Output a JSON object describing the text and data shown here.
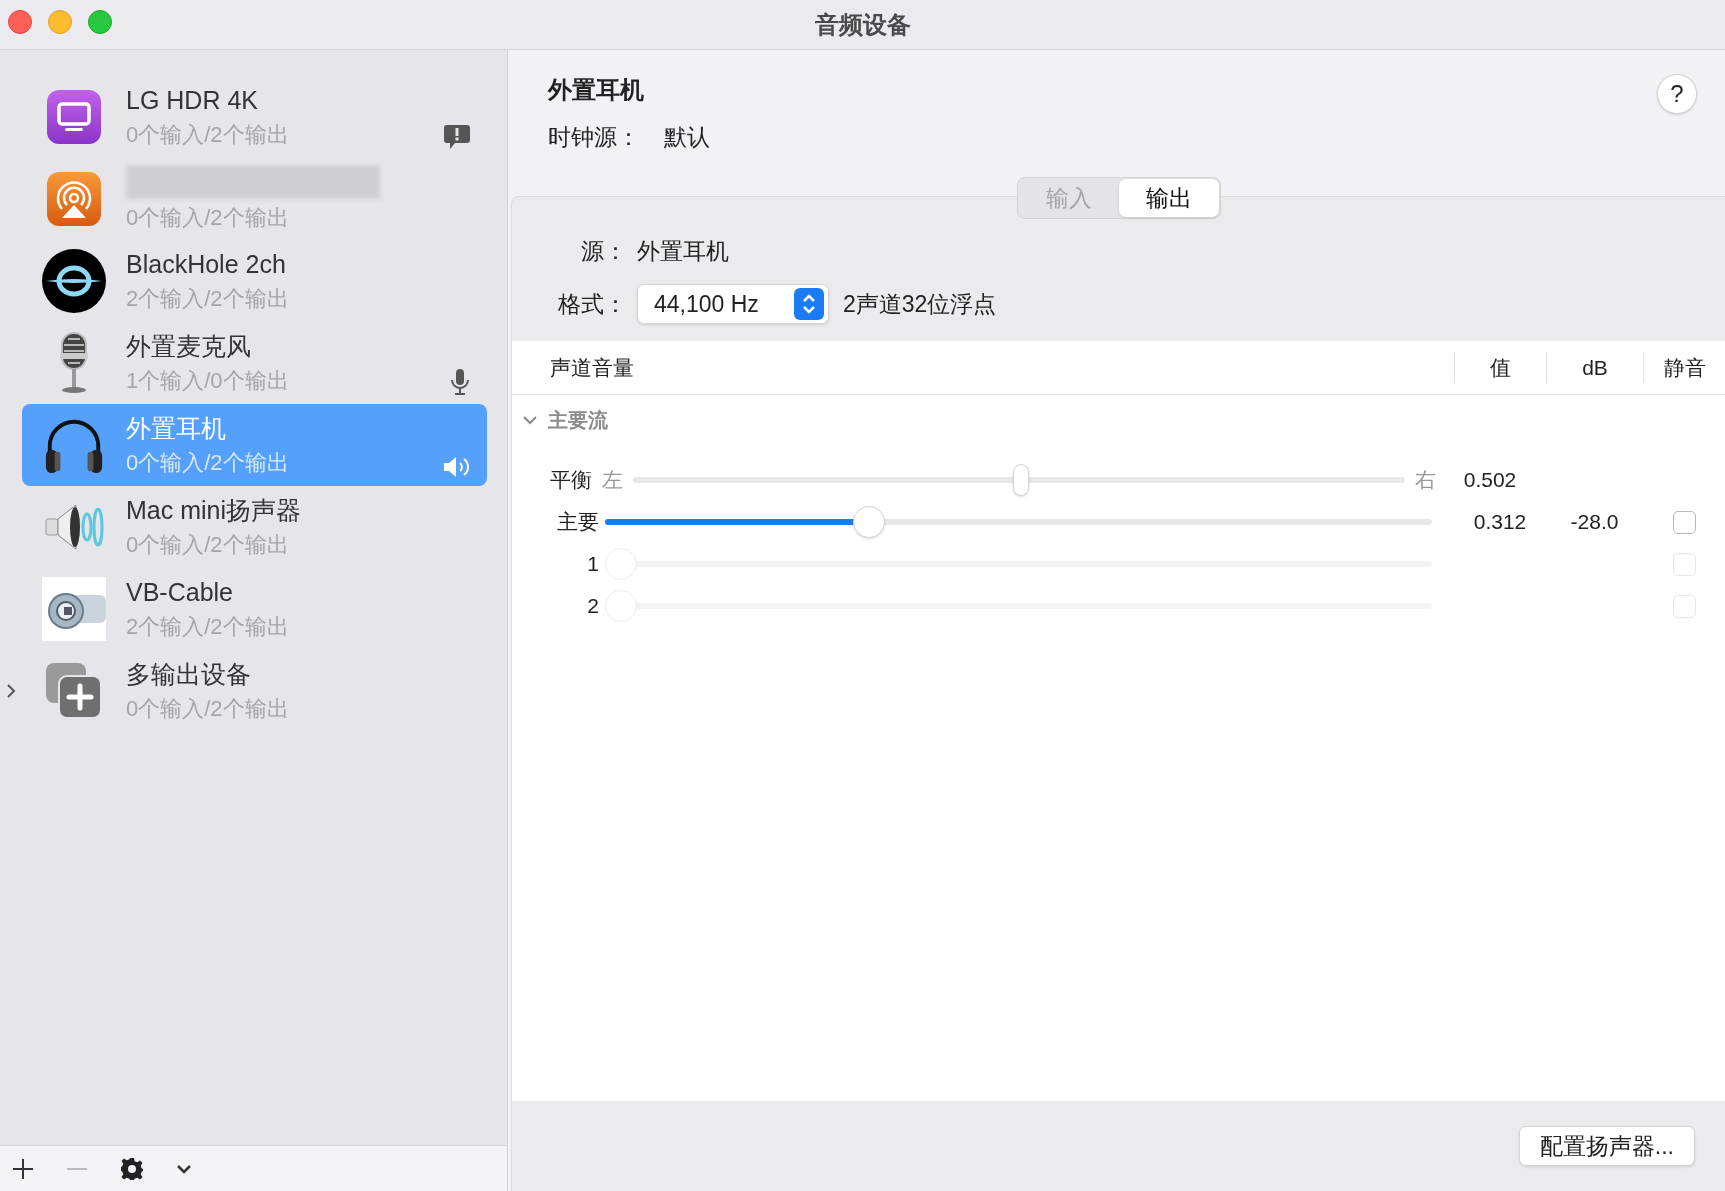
{
  "window": {
    "title": "音频设备"
  },
  "devices": [
    {
      "kind": "display",
      "name": "LG HDR 4K",
      "io": "0个输入/2个输出",
      "badge": {
        "kind": "alert"
      },
      "selected": false
    },
    {
      "kind": "airplay",
      "redacted": true,
      "io": "0个输入/2个输出",
      "selected": false
    },
    {
      "kind": "blackhole",
      "name": "BlackHole 2ch",
      "io": "2个输入/2个输出",
      "selected": false
    },
    {
      "kind": "microphone",
      "name": "外置麦克风",
      "io": "1个输入/0个输出",
      "badge": {
        "kind": "mic"
      },
      "selected": false
    },
    {
      "kind": "headphones",
      "name": "外置耳机",
      "io": "0个输入/2个输出",
      "badge": {
        "kind": "speaker"
      },
      "selected": true
    },
    {
      "kind": "speaker",
      "name": "Mac mini扬声器",
      "io": "0个输入/2个输出",
      "selected": false
    },
    {
      "kind": "cable",
      "name": "VB-Cable",
      "io": "2个输入/2个输出",
      "selected": false
    },
    {
      "kind": "aggregate",
      "name": "多输出设备",
      "io": "0个输入/2个输出",
      "expanded": false,
      "selected": false
    }
  ],
  "sidebar_toolbar": {
    "remove_disabled": true
  },
  "detail": {
    "title": "外置耳机",
    "clock_label": "时钟源：",
    "clock_value": "默认",
    "help": "?",
    "tabs": [
      {
        "label": "输入",
        "selected": false
      },
      {
        "label": "输出",
        "selected": true
      }
    ],
    "source_label": "源：",
    "source_value": "外置耳机",
    "format_label": "格式：",
    "format_value": "44,100 Hz",
    "format_desc": "2声道32位浮点",
    "columns": [
      "声道音量",
      "值",
      "dB",
      "静音"
    ],
    "stream": {
      "label": "主要流",
      "expanded": true
    },
    "balance": {
      "label": "平衡",
      "left": "左",
      "right": "右",
      "level": 0.502,
      "value": "0.502"
    },
    "channels": [
      {
        "label": "主要",
        "level": 0.312,
        "value": "0.312",
        "db": "-28.0",
        "muted": false,
        "disabled": false
      },
      {
        "label": "1",
        "level": 0,
        "muted": false,
        "disabled": true
      },
      {
        "label": "2",
        "level": 0,
        "muted": false,
        "disabled": true
      }
    ],
    "configure_button": "配置扬声器..."
  }
}
